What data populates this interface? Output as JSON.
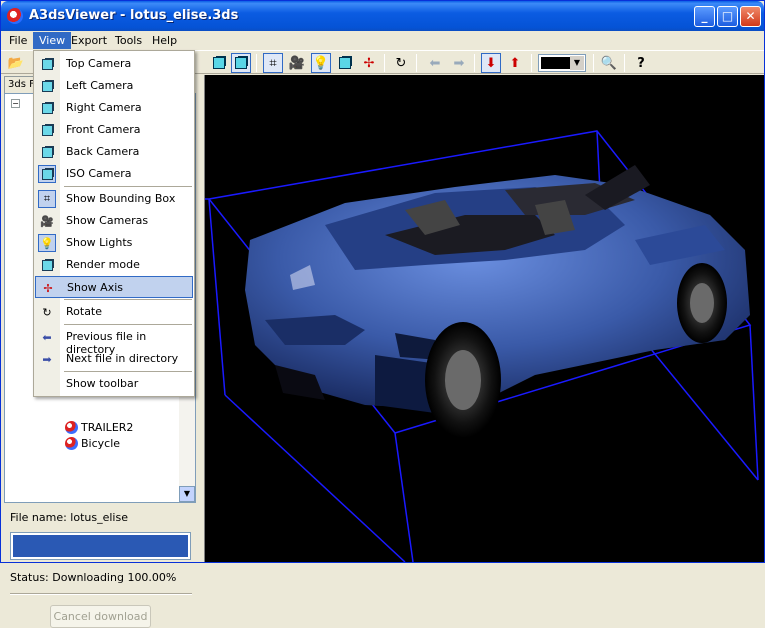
{
  "window": {
    "title": "A3dsViewer - lotus_elise.3ds"
  },
  "menubar": {
    "items": [
      "File",
      "View",
      "Export",
      "Tools",
      "Help"
    ]
  },
  "view_menu": {
    "items": [
      "Top Camera",
      "Left Camera",
      "Right Camera",
      "Front Camera",
      "Back Camera",
      "ISO Camera",
      "Show Bounding Box",
      "Show Cameras",
      "Show Lights",
      "Render mode",
      "Show Axis",
      "Rotate",
      "Previous file in directory",
      "Next file in directory",
      "Show toolbar"
    ],
    "highlighted": "Show Axis"
  },
  "left_panel": {
    "tab_label": "3ds F",
    "tree_items": [
      "TRAILER2",
      "Bicycle"
    ],
    "file_name_label": "File name: lotus_elise",
    "status_label": "Status: Downloading  100.00%",
    "progress": 1.0,
    "cancel_label": "Cancel download"
  },
  "toolbar": {
    "background_color": "#000000"
  },
  "colors": {
    "bounding_box": "#1a1aff",
    "car_body": "#3a5aa8",
    "viewport_bg": "#000000"
  }
}
